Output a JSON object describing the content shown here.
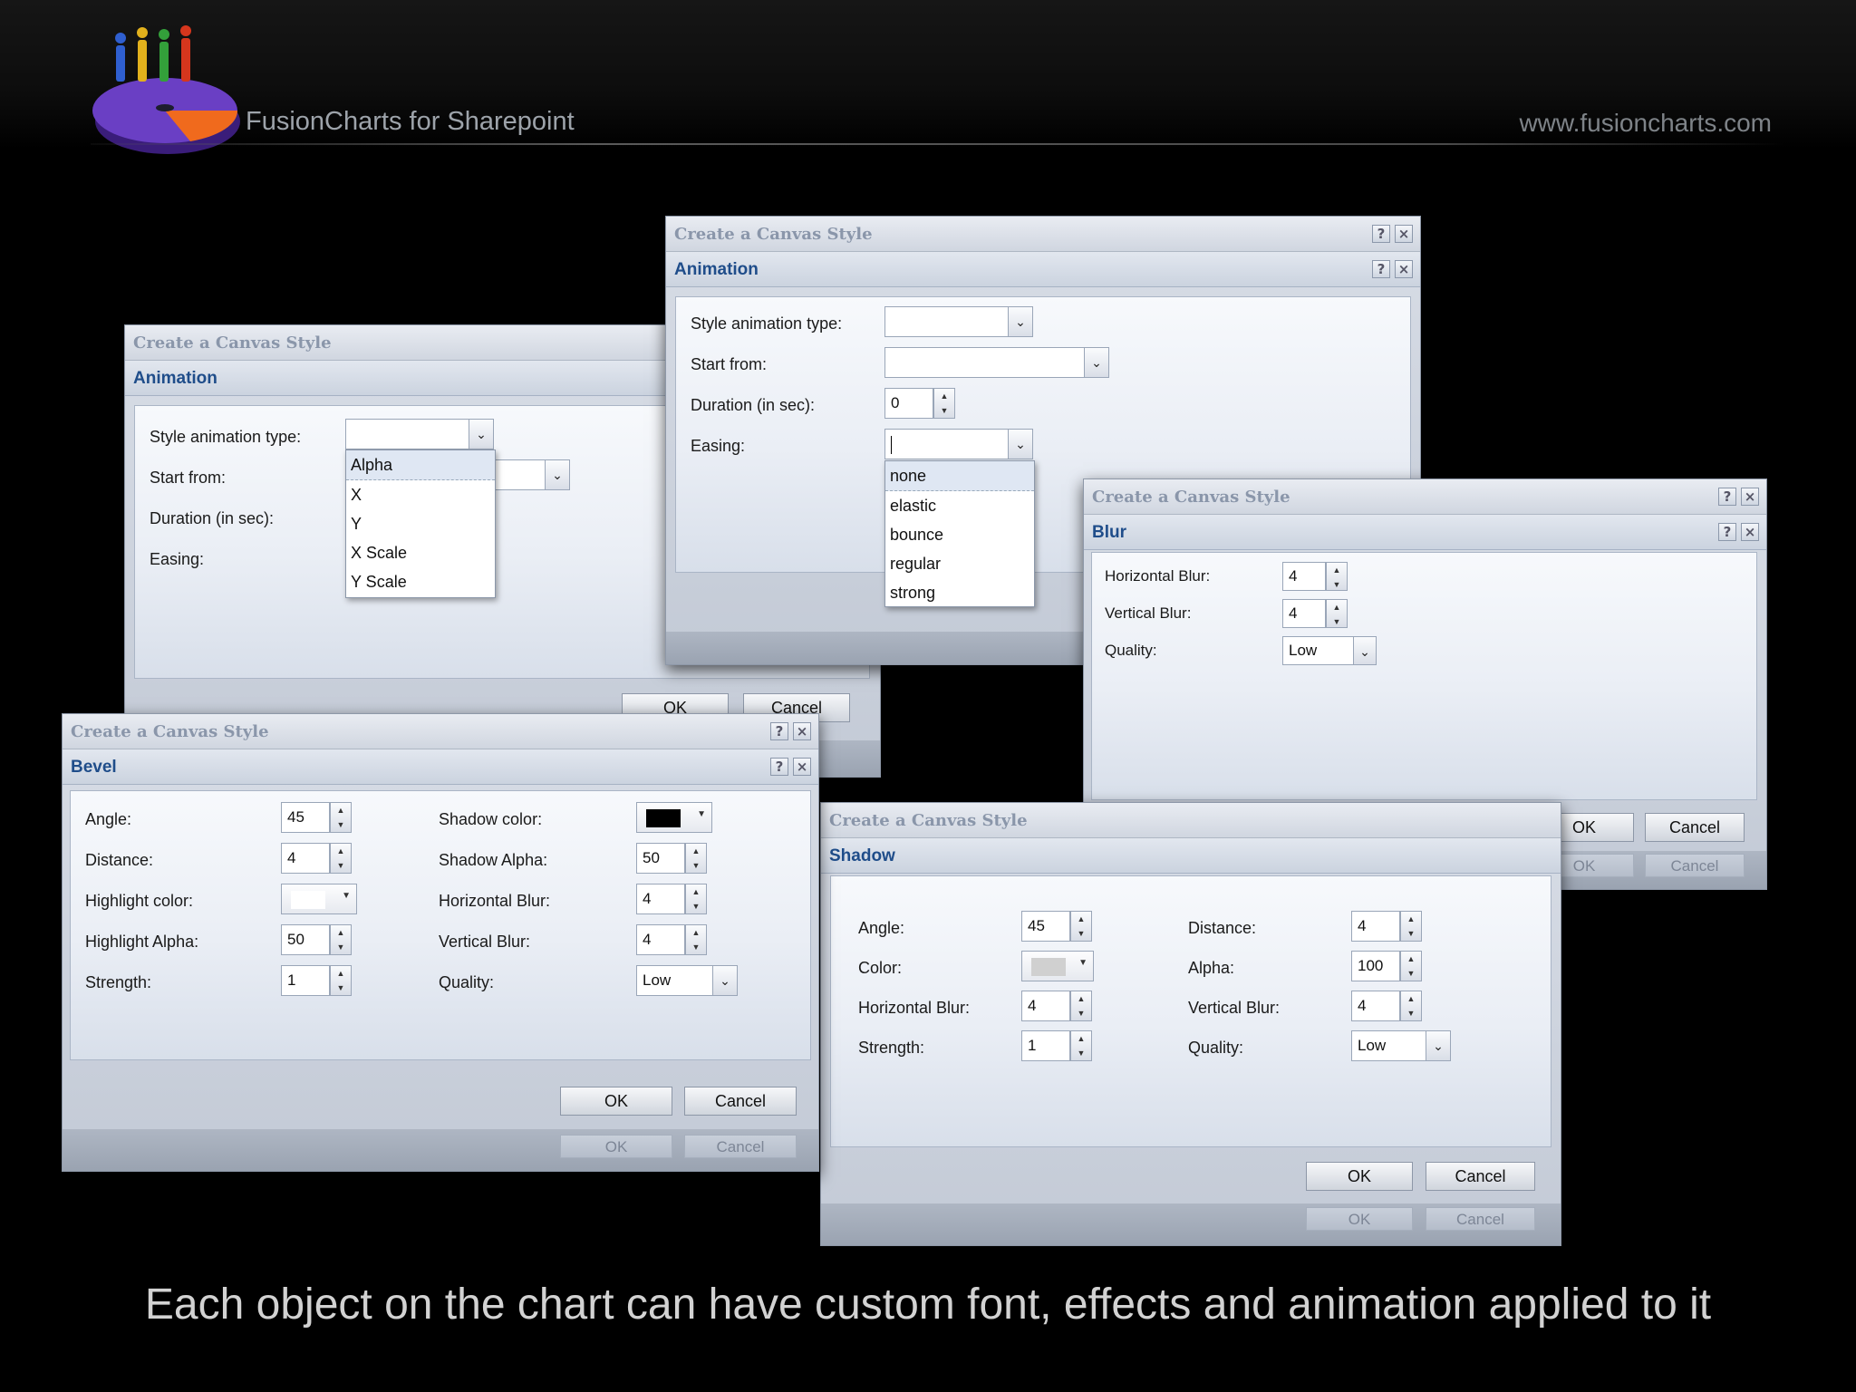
{
  "header": {
    "brand": "FusionCharts for Sharepoint",
    "website": "www.fusioncharts.com"
  },
  "caption": "Each object on the chart can have custom font, effects and animation applied to it",
  "icons": {
    "help": "help-icon",
    "close": "close-icon"
  },
  "dialogs": {
    "animation_left": {
      "title": "Create a Canvas Style",
      "section": "Animation",
      "labels": [
        "Style animation type:",
        "Start from:",
        "Duration (in sec):",
        "Easing:"
      ],
      "dropdown_options": [
        "Alpha",
        "X",
        "Y",
        "X Scale",
        "Y Scale"
      ],
      "ok": "OK",
      "cancel": "Cancel"
    },
    "animation_top": {
      "title": "Create a Canvas Style",
      "section": "Animation",
      "labels": [
        "Style animation type:",
        "Start from:",
        "Duration (in sec):",
        "Easing:"
      ],
      "duration": "0",
      "easing_options": [
        "none",
        "elastic",
        "bounce",
        "regular",
        "strong"
      ]
    },
    "blur": {
      "title": "Create a Canvas Style",
      "section": "Blur",
      "labels": [
        "Horizontal Blur:",
        "Vertical Blur:",
        "Quality:"
      ],
      "values": [
        "4",
        "4",
        "Low"
      ],
      "ok": "OK",
      "cancel": "Cancel"
    },
    "bevel": {
      "title": "Create a Canvas Style",
      "section": "Bevel",
      "left_labels": [
        "Angle:",
        "Distance:",
        "Highlight color:",
        "Highlight Alpha:",
        "Strength:"
      ],
      "left_values": [
        "45",
        "4",
        "",
        "50",
        "1"
      ],
      "right_labels": [
        "Shadow color:",
        "Shadow Alpha:",
        "Horizontal Blur:",
        "Vertical Blur:",
        "Quality:"
      ],
      "right_values": [
        "",
        "50",
        "4",
        "4",
        "Low"
      ],
      "shadow_color": "#000000",
      "highlight_color": "#ffffff",
      "ok": "OK",
      "cancel": "Cancel"
    },
    "shadow": {
      "title": "Create a Canvas Style",
      "section": "Shadow",
      "left_labels": [
        "Angle:",
        "Color:",
        "Horizontal Blur:",
        "Strength:"
      ],
      "left_values": [
        "45",
        "",
        "4",
        "1"
      ],
      "right_labels": [
        "Distance:",
        "Alpha:",
        "Vertical Blur:",
        "Quality:"
      ],
      "right_values": [
        "4",
        "100",
        "4",
        "Low"
      ],
      "color": "#d0d0d0",
      "ok": "OK",
      "cancel": "Cancel"
    }
  }
}
